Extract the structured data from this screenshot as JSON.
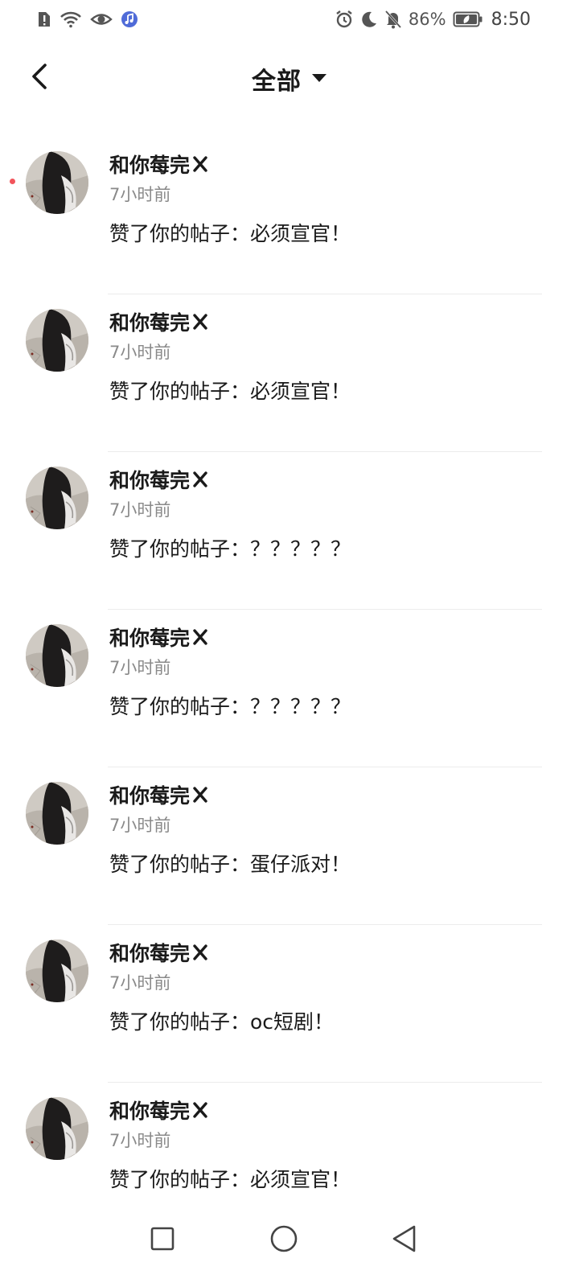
{
  "status_bar": {
    "battery_percent": "86%",
    "time": "8:50",
    "left_icons": [
      "alert-sim-icon",
      "wifi-icon",
      "eye-icon",
      "music-app-icon"
    ],
    "right_icons": [
      "alarm-icon",
      "moon-icon",
      "bell-muted-icon",
      "battery-icon"
    ]
  },
  "header": {
    "title": "全部",
    "back_icon": "chevron-left-icon",
    "dropdown_icon": "caret-down-icon"
  },
  "notifications": [
    {
      "username": "和你莓完",
      "time": "7小时前",
      "action": "赞了你的帖子：必须宣官！",
      "unread": true
    },
    {
      "username": "和你莓完",
      "time": "7小时前",
      "action": "赞了你的帖子：必须宣官！",
      "unread": false
    },
    {
      "username": "和你莓完",
      "time": "7小时前",
      "action": "赞了你的帖子：？？？？？",
      "unread": false
    },
    {
      "username": "和你莓完",
      "time": "7小时前",
      "action": "赞了你的帖子：？？？？？",
      "unread": false
    },
    {
      "username": "和你莓完",
      "time": "7小时前",
      "action": "赞了你的帖子：蛋仔派对！",
      "unread": false
    },
    {
      "username": "和你莓完",
      "time": "7小时前",
      "action": "赞了你的帖子：oc短剧！",
      "unread": false
    },
    {
      "username": "和你莓完",
      "time": "7小时前",
      "action": "赞了你的帖子：必须宣官！",
      "unread": false
    }
  ],
  "nav_bar": {
    "icons": [
      "square-recent-icon",
      "circle-home-icon",
      "triangle-back-icon"
    ]
  },
  "colors": {
    "unread_dot": "#f2545b",
    "text_primary": "#1a1a1a",
    "text_secondary": "#8a8a8a",
    "divider": "#ececec"
  }
}
